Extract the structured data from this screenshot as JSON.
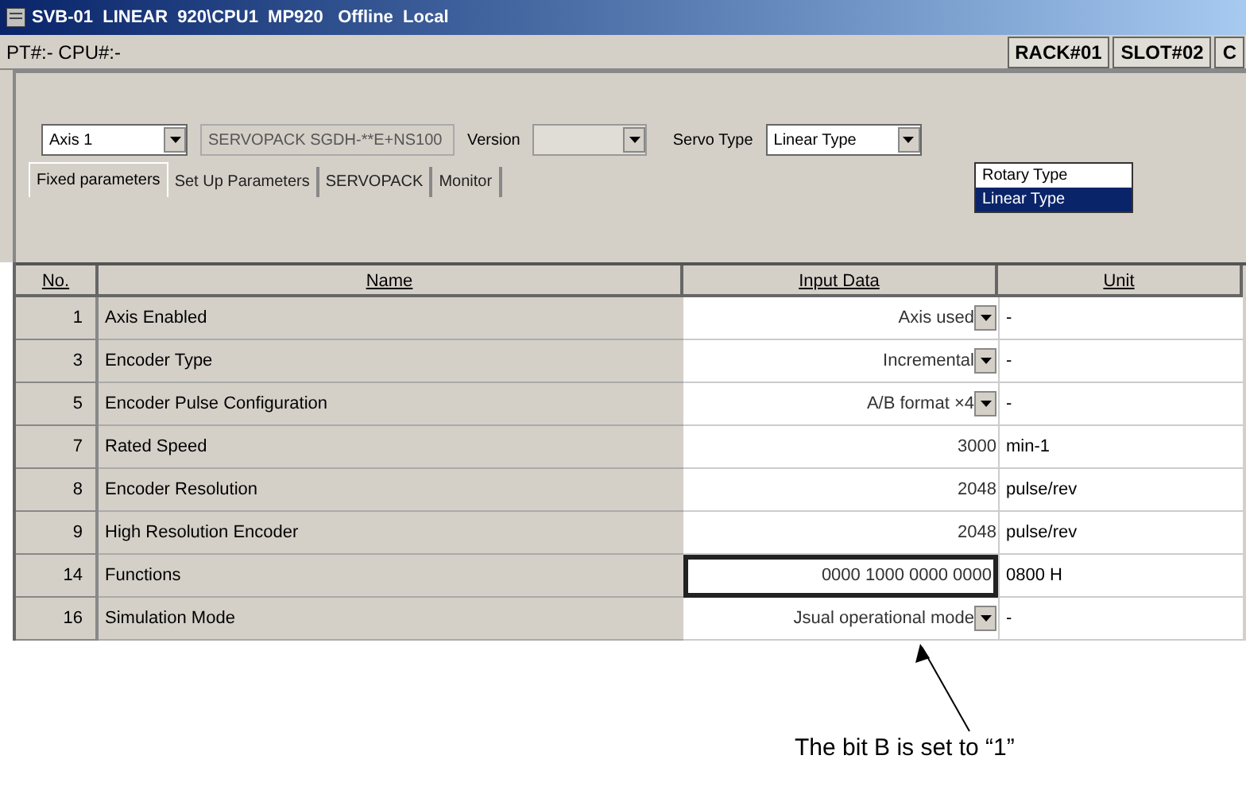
{
  "window": {
    "title": "SVB-01  LINEAR  920\\CPU1  MP920   Offline  Local"
  },
  "status_row": {
    "address": "PT#:- CPU#:-",
    "indicators": [
      "RACK#01",
      "SLOT#02",
      "C"
    ]
  },
  "controls": {
    "axis": "Axis 1",
    "servopack": "SERVOPACK SGDH-**E+NS100",
    "version_label": "Version",
    "servo_type_label": "Servo Type",
    "servo_type": "Linear Type",
    "servo_type_options": [
      {
        "label": "Rotary Type",
        "selected": false
      },
      {
        "label": "Linear Type",
        "selected": true
      }
    ]
  },
  "tabs": [
    {
      "label": "Fixed parameters",
      "selected": true
    },
    {
      "label": "Set Up Parameters",
      "selected": false
    },
    {
      "label": "SERVOPACK",
      "selected": false
    },
    {
      "label": "Monitor",
      "selected": false
    }
  ],
  "table": {
    "columns": [
      "No.",
      "Name",
      "Input Data",
      "Unit"
    ],
    "rows": [
      {
        "no": "1",
        "name": "Axis Enabled",
        "input": "Axis used",
        "kind": "dropdown",
        "unit": "-",
        "selected": false
      },
      {
        "no": "3",
        "name": "Encoder Type",
        "input": "Incremental",
        "kind": "dropdown",
        "unit": "-",
        "selected": false
      },
      {
        "no": "5",
        "name": "Encoder Pulse Configuration",
        "input": "A/B format ×4",
        "kind": "dropdown",
        "unit": "-",
        "selected": false
      },
      {
        "no": "7",
        "name": "Rated Speed",
        "input": "3000",
        "kind": "number",
        "unit": "min-1",
        "selected": false
      },
      {
        "no": "8",
        "name": "Encoder Resolution",
        "input": "2048",
        "kind": "number",
        "unit": "pulse/rev",
        "selected": false
      },
      {
        "no": "9",
        "name": "High Resolution Encoder",
        "input": "2048",
        "kind": "number",
        "unit": "pulse/rev",
        "selected": false
      },
      {
        "no": "14",
        "name": "Functions",
        "input": "0000 1000 0000 0000",
        "kind": "number",
        "unit": "0800 H",
        "selected": true
      },
      {
        "no": "16",
        "name": "Simulation Mode",
        "input": "Jsual operational mode",
        "kind": "dropdown",
        "unit": "-",
        "selected": false
      }
    ]
  },
  "annotation": {
    "text": "The bit B is set to “1”"
  }
}
